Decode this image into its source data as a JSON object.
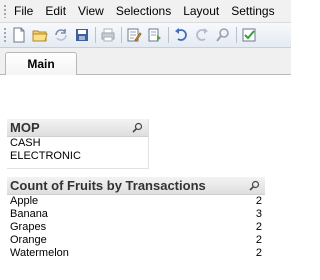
{
  "menu": {
    "items": [
      {
        "name": "menu-file",
        "label": "File"
      },
      {
        "name": "menu-edit",
        "label": "Edit"
      },
      {
        "name": "menu-view",
        "label": "View"
      },
      {
        "name": "menu-selections",
        "label": "Selections"
      },
      {
        "name": "menu-layout",
        "label": "Layout"
      },
      {
        "name": "menu-settings",
        "label": "Settings"
      }
    ]
  },
  "toolbar": {
    "icons": [
      "grip",
      "new-document-icon",
      "open-folder-icon",
      "reload-icon",
      "save-icon",
      "print-icon",
      "edit-script-icon",
      "reload-data-icon",
      "undo-icon",
      "redo-icon",
      "search-icon",
      "check-icon"
    ]
  },
  "tabs": [
    {
      "label": "Main"
    }
  ],
  "mop_listbox": {
    "title": "MOP",
    "items": [
      "CASH",
      "ELECTRONIC"
    ]
  },
  "count_box": {
    "title": "Count of Fruits by Transactions",
    "rows": [
      {
        "label": "Apple",
        "value": "2"
      },
      {
        "label": "Banana",
        "value": "3"
      },
      {
        "label": "Grapes",
        "value": "2"
      },
      {
        "label": "Orange",
        "value": "2"
      },
      {
        "label": "Watermelon",
        "value": "2"
      }
    ]
  }
}
